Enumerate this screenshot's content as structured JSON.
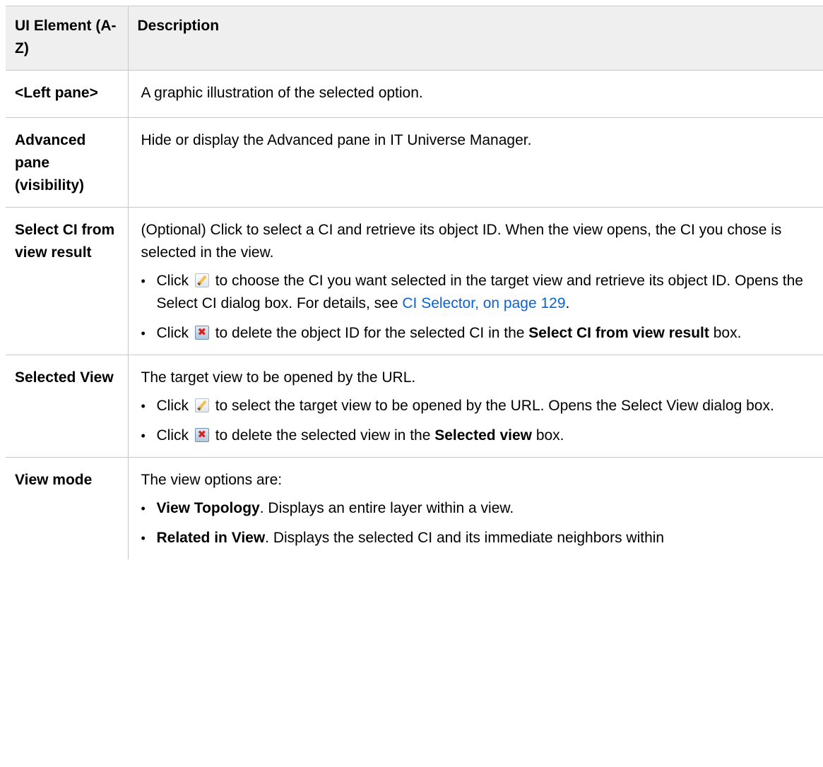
{
  "table": {
    "header": {
      "col1": "UI Element (A-Z)",
      "col2": "Description"
    },
    "rows": [
      {
        "element": "<Left pane>",
        "description": "A graphic illustration of the selected option."
      },
      {
        "element": "Advanced pane (visibility)",
        "description": "Hide or display the Advanced pane in IT Universe Manager."
      },
      {
        "element": "Select CI from view result",
        "description": "(Optional) Click to select a CI and retrieve its object ID. When the view opens, the CI you chose is selected in the view.",
        "bullets": [
          {
            "prefix": "Click",
            "icon": "edit-pencil-icon",
            "text": "to choose the CI you want selected in the target view and retrieve its object ID. Opens the Select CI dialog box. For details, see",
            "link": "CI Selector, on page 129",
            "suffix": "."
          },
          {
            "prefix": "Click",
            "icon": "delete-x-icon",
            "text": "to delete the object ID for the selected CI in the",
            "bold": "Select CI from view result",
            "suffix": "box."
          }
        ]
      },
      {
        "element": "Selected View",
        "description": "The target view to be opened by the URL.",
        "bullets": [
          {
            "prefix": "Click",
            "icon": "edit-pencil-icon",
            "text": "to select the target view to be opened by the URL. Opens the Select View dialog box."
          },
          {
            "prefix": "Click",
            "icon": "delete-x-icon",
            "text": "to delete the selected view in the",
            "bold": "Selected view",
            "suffix": "box."
          }
        ]
      },
      {
        "element": "View mode",
        "description": "The view options are:",
        "bullets": [
          {
            "bold": "View Topology",
            "text": ". Displays an entire layer within a view."
          },
          {
            "bold": "Related in View",
            "text": ". Displays the selected CI and its immediate neighbors within"
          }
        ]
      }
    ]
  }
}
